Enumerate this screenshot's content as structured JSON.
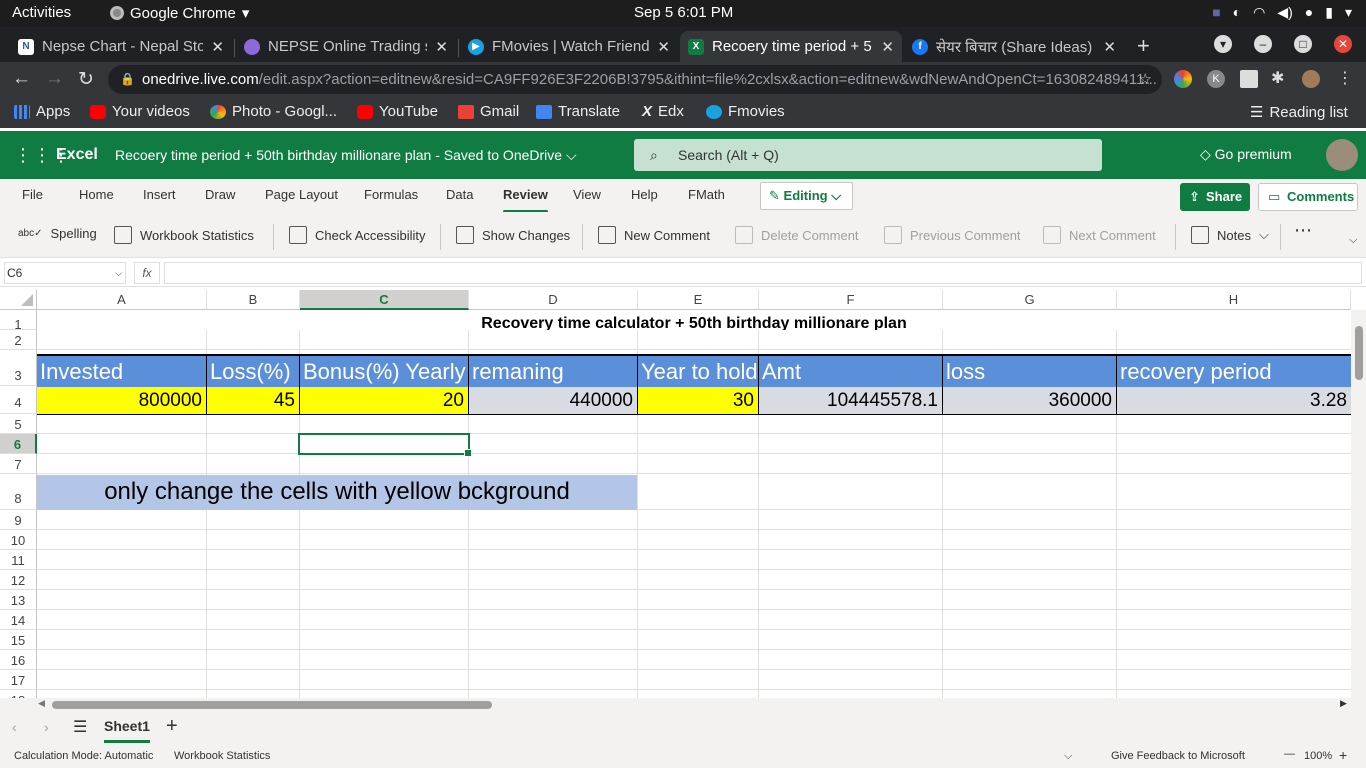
{
  "os": {
    "activities": "Activities",
    "app": "Google Chrome",
    "clock": "Sep 5  6:01 PM"
  },
  "browser": {
    "tabs": [
      {
        "title": "Nepse Chart - Nepal Sto",
        "icon": "nepse-icon"
      },
      {
        "title": "NEPSE Online Trading s",
        "icon": "nepse-trading-icon"
      },
      {
        "title": "FMovies | Watch Friend",
        "icon": "fmovies-icon"
      },
      {
        "title": "Recoery time period + 5",
        "icon": "excel-icon"
      },
      {
        "title": "सेयर बिचार (Share Ideas) |",
        "icon": "facebook-icon"
      }
    ],
    "url_host": "onedrive.live.com",
    "url_path": "/edit.aspx?action=editnew&resid=CA9FF926E3F2206B!3795&ithint=file%2cxlsx&action=editnew&wdNewAndOpenCt=163082489411...",
    "bookmarks": [
      {
        "label": "Apps",
        "color": "#4285f4"
      },
      {
        "label": "Your videos",
        "color": "#ff0000"
      },
      {
        "label": "Photo - Googl...",
        "color": "#fbbc05"
      },
      {
        "label": "YouTube",
        "color": "#ff0000"
      },
      {
        "label": "Gmail",
        "color": "#ea4335"
      },
      {
        "label": "Translate",
        "color": "#4285f4"
      },
      {
        "label": "Edx",
        "color": "#ffffff"
      },
      {
        "label": "Fmovies",
        "color": "#1aa1e0"
      }
    ],
    "reading_list": "Reading list"
  },
  "excel": {
    "app": "Excel",
    "title": "Recoery time period + 50th birthday millionare plan  -  Saved to OneDrive ⌵",
    "search": "Search (Alt + Q)",
    "premium": "Go premium",
    "ribbon_tabs": [
      "File",
      "Home",
      "Insert",
      "Draw",
      "Page Layout",
      "Formulas",
      "Data",
      "Review",
      "View",
      "Help",
      "FMath"
    ],
    "active_tab": "Review",
    "editing": "Editing",
    "share": "Share",
    "comments": "Comments",
    "commands": [
      "Spelling",
      "Workbook Statistics",
      "Check Accessibility",
      "Show Changes",
      "New Comment",
      "Delete Comment",
      "Previous Comment",
      "Next Comment",
      "Notes"
    ],
    "name_box": "C6",
    "fx": "fx",
    "columns": [
      "A",
      "B",
      "C",
      "D",
      "E",
      "F",
      "G",
      "H"
    ],
    "rows": [
      "1",
      "2",
      "3",
      "4",
      "5",
      "6",
      "7",
      "8",
      "9",
      "10",
      "11",
      "12",
      "13",
      "14",
      "15",
      "16",
      "17",
      "18"
    ],
    "sheet_title": "Recovery time calculator + 50th birthday millionare plan",
    "headers": [
      "Invested",
      "Loss(%)",
      "Bonus(%) Yearly",
      "remaning",
      "Year to hold",
      "Amt",
      "loss",
      "recovery period"
    ],
    "values": [
      "800000",
      "45",
      "20",
      "440000",
      "30",
      "104445578.1",
      "360000",
      "3.28"
    ],
    "note": "only change the cells with yellow bckground",
    "sheet_tab": "Sheet1",
    "status_calc": "Calculation Mode: Automatic",
    "status_stats": "Workbook Statistics",
    "feedback": "Give Feedback to Microsoft",
    "zoom": "100%",
    "colors": {
      "brand": "#107c41",
      "header_fill": "#5b8fd9",
      "input_fill": "#ffff00",
      "calc_fill": "#d9dbe3",
      "note_fill": "#b4c6e7"
    }
  }
}
